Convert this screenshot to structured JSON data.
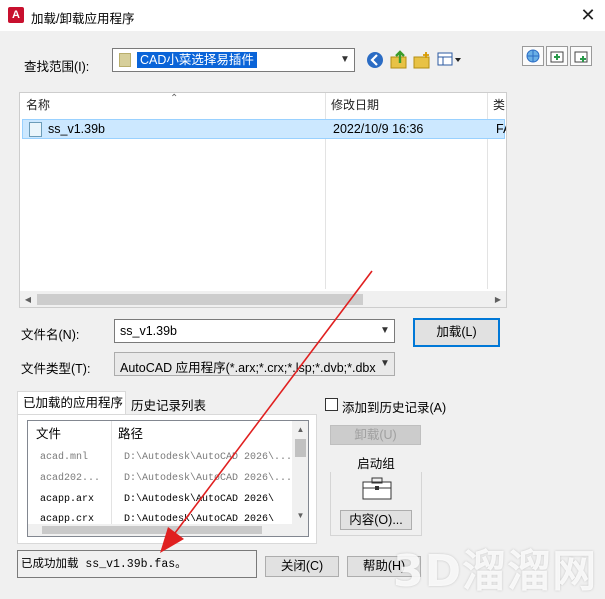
{
  "window": {
    "title": "加载/卸载应用程序",
    "icon_letter": "A",
    "close_glyph": "✕",
    "accent_color": "#c8102e"
  },
  "look_in": {
    "label": "查找范围(I):",
    "value": "CAD小菜选择易插件"
  },
  "toolbar": {
    "icons": [
      "back-icon",
      "up-folder-icon",
      "new-folder-icon",
      "views-menu-icon",
      "search-web-icon",
      "add-favorite-icon",
      "add-places-icon"
    ]
  },
  "file_list": {
    "headers": {
      "name": "名称",
      "date": "修改日期",
      "type": "类型"
    },
    "rows": [
      {
        "name": "ss_v1.39b",
        "date": "2022/10/9 16:36",
        "type": "FA"
      }
    ]
  },
  "file_name": {
    "label": "文件名(N):",
    "value": "ss_v1.39b",
    "load_button": "加载(L)"
  },
  "file_type": {
    "label": "文件类型(T):",
    "value": "AutoCAD 应用程序(*.arx;*.crx;*.lsp;*.dvb;*.dbx"
  },
  "tabs": {
    "loaded": "已加载的应用程序",
    "history": "历史记录列表"
  },
  "loaded_list": {
    "headers": {
      "file": "文件",
      "path": "路径"
    },
    "rows": [
      {
        "file": "acad.mnl",
        "path": "D:\\Autodesk\\AutoCAD 2026\\...",
        "dim": true
      },
      {
        "file": "acad202...",
        "path": "D:\\Autodesk\\AutoCAD 2026\\...",
        "dim": true
      },
      {
        "file": "acapp.arx",
        "path": "D:\\Autodesk\\AutoCAD 2026\\",
        "dim": false
      },
      {
        "file": "acapp.crx",
        "path": "D:\\Autodesk\\AutoCAD 2026\\",
        "dim": false
      }
    ]
  },
  "add_history": {
    "label": "添加到历史记录(A)",
    "checked": false
  },
  "unload_button": "卸载(U)",
  "startup": {
    "title": "启动组",
    "contents_button": "内容(O)..."
  },
  "status": {
    "text": "已成功加载 ss_v1.39b.fas。"
  },
  "buttons": {
    "close": "关闭(C)",
    "help": "帮助(H)"
  },
  "watermark": "3D溜溜网"
}
